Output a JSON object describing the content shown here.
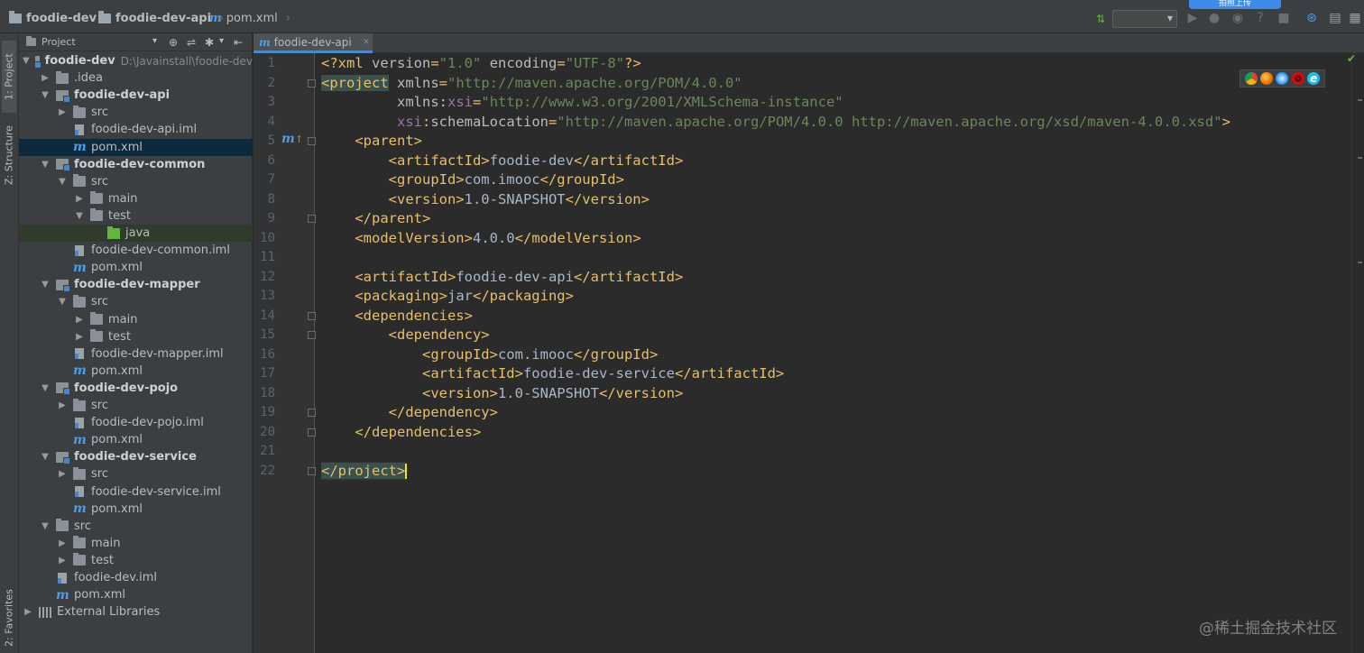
{
  "breadcrumb": {
    "items": [
      "foodie-dev",
      "foodie-dev-api",
      "pom.xml"
    ]
  },
  "cloud_badge": "拍照上传",
  "tool_stripe": {
    "project_tab": "1: Project",
    "structure_tab": "Z: Structure",
    "favorites_tab": "2: Favorites"
  },
  "project_panel": {
    "title": "Project",
    "tree": [
      {
        "label": "foodie-dev",
        "path": "D:\\Javainstall\\foodie-dev",
        "bold": true,
        "icon": "module",
        "arrow": "down",
        "level": 0
      },
      {
        "label": ".idea",
        "icon": "folder",
        "arrow": "right",
        "level": 1
      },
      {
        "label": "foodie-dev-api",
        "bold": true,
        "icon": "module",
        "arrow": "down",
        "level": 1
      },
      {
        "label": "src",
        "icon": "folder",
        "arrow": "right",
        "level": 2
      },
      {
        "label": "foodie-dev-api.iml",
        "icon": "iml",
        "arrow": "",
        "level": 2
      },
      {
        "label": "pom.xml",
        "icon": "maven",
        "arrow": "",
        "level": 2,
        "selected": true
      },
      {
        "label": "foodie-dev-common",
        "bold": true,
        "icon": "module",
        "arrow": "down",
        "level": 1
      },
      {
        "label": "src",
        "icon": "folder",
        "arrow": "down",
        "level": 2
      },
      {
        "label": "main",
        "icon": "folder",
        "arrow": "right",
        "level": 3
      },
      {
        "label": "test",
        "icon": "folder",
        "arrow": "down",
        "level": 3
      },
      {
        "label": "java",
        "icon": "java",
        "arrow": "",
        "level": 4,
        "highlight": true
      },
      {
        "label": "foodie-dev-common.iml",
        "icon": "iml",
        "arrow": "",
        "level": 2
      },
      {
        "label": "pom.xml",
        "icon": "maven",
        "arrow": "",
        "level": 2
      },
      {
        "label": "foodie-dev-mapper",
        "bold": true,
        "icon": "module",
        "arrow": "down",
        "level": 1
      },
      {
        "label": "src",
        "icon": "folder",
        "arrow": "down",
        "level": 2
      },
      {
        "label": "main",
        "icon": "folder",
        "arrow": "right",
        "level": 3
      },
      {
        "label": "test",
        "icon": "folder",
        "arrow": "right",
        "level": 3
      },
      {
        "label": "foodie-dev-mapper.iml",
        "icon": "iml",
        "arrow": "",
        "level": 2
      },
      {
        "label": "pom.xml",
        "icon": "maven",
        "arrow": "",
        "level": 2
      },
      {
        "label": "foodie-dev-pojo",
        "bold": true,
        "icon": "module",
        "arrow": "down",
        "level": 1
      },
      {
        "label": "src",
        "icon": "folder",
        "arrow": "right",
        "level": 2
      },
      {
        "label": "foodie-dev-pojo.iml",
        "icon": "iml",
        "arrow": "",
        "level": 2
      },
      {
        "label": "pom.xml",
        "icon": "maven",
        "arrow": "",
        "level": 2
      },
      {
        "label": "foodie-dev-service",
        "bold": true,
        "icon": "module",
        "arrow": "down",
        "level": 1
      },
      {
        "label": "src",
        "icon": "folder",
        "arrow": "right",
        "level": 2
      },
      {
        "label": "foodie-dev-service.iml",
        "icon": "iml",
        "arrow": "",
        "level": 2
      },
      {
        "label": "pom.xml",
        "icon": "maven",
        "arrow": "",
        "level": 2
      },
      {
        "label": "src",
        "icon": "folder",
        "arrow": "down",
        "level": 1
      },
      {
        "label": "main",
        "icon": "folder",
        "arrow": "right",
        "level": 2
      },
      {
        "label": "test",
        "icon": "folder",
        "arrow": "right",
        "level": 2
      },
      {
        "label": "foodie-dev.iml",
        "icon": "iml",
        "arrow": "",
        "level": 1
      },
      {
        "label": "pom.xml",
        "icon": "maven",
        "arrow": "",
        "level": 1
      },
      {
        "label": "External Libraries",
        "icon": "lib",
        "arrow": "right",
        "level": 0
      }
    ]
  },
  "editor": {
    "tab_label": "foodie-dev-api",
    "line_numbers": [
      "1",
      "2",
      "3",
      "4",
      "5",
      "6",
      "7",
      "8",
      "9",
      "10",
      "11",
      "12",
      "13",
      "14",
      "15",
      "16",
      "17",
      "18",
      "19",
      "20",
      "21",
      "22"
    ],
    "lines": [
      [
        [
          "t",
          "<?xml "
        ],
        [
          "a",
          "version"
        ],
        [
          "t",
          "="
        ],
        [
          "v",
          "\"1.0\""
        ],
        [
          "t",
          " "
        ],
        [
          "a",
          "encoding"
        ],
        [
          "t",
          "="
        ],
        [
          "v",
          "\"UTF-8\""
        ],
        [
          "t",
          "?>"
        ]
      ],
      [
        [
          "m",
          "<project"
        ],
        [
          "t",
          " "
        ],
        [
          "a",
          "xmlns"
        ],
        [
          "t",
          "="
        ],
        [
          "v",
          "\"http://maven.apache.org/POM/4.0.0\""
        ]
      ],
      [
        [
          "t",
          "         "
        ],
        [
          "a",
          "xmlns"
        ],
        [
          "t",
          ":"
        ],
        [
          "ns",
          "xsi"
        ],
        [
          "t",
          "="
        ],
        [
          "v",
          "\"http://www.w3.org/2001/XMLSchema-instance\""
        ]
      ],
      [
        [
          "t",
          "         "
        ],
        [
          "ns",
          "xsi"
        ],
        [
          "t",
          ":"
        ],
        [
          "a",
          "schemaLocation"
        ],
        [
          "t",
          "="
        ],
        [
          "v",
          "\"http://maven.apache.org/POM/4.0.0 http://maven.apache.org/xsd/maven-4.0.0.xsd\""
        ],
        [
          "t",
          ">"
        ]
      ],
      [
        [
          "t",
          "    <parent>"
        ]
      ],
      [
        [
          "t",
          "        <artifactId>"
        ],
        [
          "p",
          "foodie-dev"
        ],
        [
          "t",
          "</artifactId>"
        ]
      ],
      [
        [
          "t",
          "        <groupId>"
        ],
        [
          "p",
          "com.imooc"
        ],
        [
          "t",
          "</groupId>"
        ]
      ],
      [
        [
          "t",
          "        <version>"
        ],
        [
          "p",
          "1.0-SNAPSHOT"
        ],
        [
          "t",
          "</version>"
        ]
      ],
      [
        [
          "t",
          "    </parent>"
        ]
      ],
      [
        [
          "t",
          "    <modelVersion>"
        ],
        [
          "p",
          "4.0.0"
        ],
        [
          "t",
          "</modelVersion>"
        ]
      ],
      [],
      [
        [
          "t",
          "    <artifactId>"
        ],
        [
          "p",
          "foodie-dev-api"
        ],
        [
          "t",
          "</artifactId>"
        ]
      ],
      [
        [
          "t",
          "    <packaging>"
        ],
        [
          "p",
          "jar"
        ],
        [
          "t",
          "</packaging>"
        ]
      ],
      [
        [
          "t",
          "    <dependencies>"
        ]
      ],
      [
        [
          "t",
          "        <dependency>"
        ]
      ],
      [
        [
          "t",
          "            <groupId>"
        ],
        [
          "p",
          "com.imooc"
        ],
        [
          "t",
          "</groupId>"
        ]
      ],
      [
        [
          "t",
          "            <artifactId>"
        ],
        [
          "p",
          "foodie-dev-service"
        ],
        [
          "t",
          "</artifactId>"
        ]
      ],
      [
        [
          "t",
          "            <version>"
        ],
        [
          "p",
          "1.0-SNAPSHOT"
        ],
        [
          "t",
          "</version>"
        ]
      ],
      [
        [
          "t",
          "        </dependency>"
        ]
      ],
      [
        [
          "t",
          "    </dependencies>"
        ]
      ],
      [],
      [
        [
          "m",
          "</project>"
        ],
        [
          "caret",
          ""
        ]
      ]
    ],
    "fold_lines": [
      2,
      5,
      9,
      14,
      15,
      19,
      20,
      22
    ]
  },
  "colors": {
    "tag": "#e8bf6a",
    "attribute": "#bababa",
    "string": "#6a8759",
    "namespace": "#9876aa",
    "plain": "#a9b7c6",
    "selection": "#0d293e",
    "accent": "#4a88c7"
  },
  "icons": [
    "project-folder-icon",
    "target-icon",
    "collapse-icon",
    "gear-icon",
    "hide-icon",
    "maven-file-icon",
    "chrome-icon",
    "firefox-icon",
    "safari-icon",
    "opera-icon",
    "ie-icon",
    "run-icon",
    "debug-icon",
    "stop-icon",
    "help-icon",
    "search-icon"
  ],
  "watermark": "@稀土掘金技术社区"
}
